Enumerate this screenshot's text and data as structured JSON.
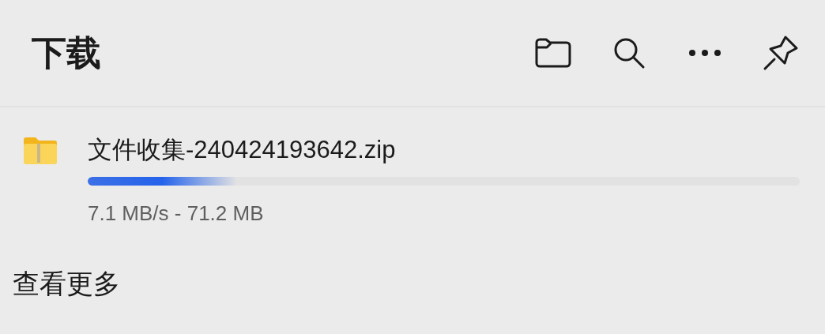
{
  "header": {
    "title": "下载"
  },
  "downloads": [
    {
      "file_name": "文件收集-240424193642.zip",
      "level": 0.21,
      "status": "7.1 MB/s - 71.2 MB"
    }
  ],
  "footer": {
    "link": "查看更多"
  }
}
